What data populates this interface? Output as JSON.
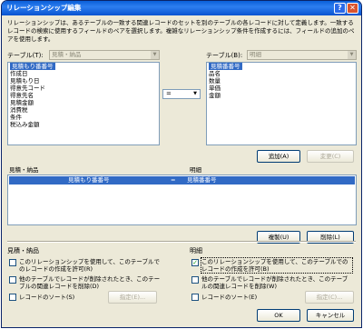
{
  "window": {
    "title": "リレーションシップ編集",
    "help_label": "?",
    "close_label": "✕"
  },
  "description": "リレーションシップは、あるテーブルの一致する関連レコードのセットを別のテーブルの各レコードに対して定義します。一致するレコードの検索に使用するフィールドのペアを選択します。複雑なリレーションシップ条件を作成するには、フィールドの追加のペアを使用します。",
  "left_table": {
    "label": "テーブル(T):",
    "value": "見積・納品",
    "fields": [
      "見積もり番番号",
      "作成日",
      "見積もり日",
      "得意先コード",
      "得意先名",
      "見積金額",
      "消費税",
      "条件",
      "税込み金額"
    ],
    "selected_index": 0
  },
  "right_table": {
    "label": "テーブル(B):",
    "value": "明細",
    "fields": [
      "見積番番号",
      "品名",
      "数量",
      "単価",
      "金額"
    ],
    "selected_index": 0
  },
  "operator": {
    "value": "="
  },
  "buttons": {
    "add": "追加(A)",
    "change": "変更(C)",
    "duplicate": "複製(U)",
    "delete": "削除(L)",
    "left_sort_spec": "指定(E)...",
    "right_sort_spec": "指定(C)...",
    "ok": "OK",
    "cancel": "キャンセル"
  },
  "criteria": {
    "left_header": "見積・納品",
    "right_header": "明細",
    "rows": [
      {
        "left": "見積もり番番号",
        "op": "=",
        "right": "見積番番号"
      }
    ]
  },
  "options_left": {
    "header": "見積・納品",
    "allow_create": "このリレーションシップを使用して、このテーブルでのレコードの作成を許可(R)",
    "allow_create_checked": false,
    "delete_related": "他のテーブルでレコードが削除されたとき、このテーブルの関連レコードを削除(D)",
    "delete_related_checked": false,
    "sort": "レコードのソート(S)",
    "sort_checked": false
  },
  "options_right": {
    "header": "明細",
    "allow_create": "このリレーションシップを使用して、このテーブルでのレコードの作成を許可(B)",
    "allow_create_checked": true,
    "delete_related": "他のテーブルでレコードが削除されたとき、このテーブルの関連レコードを削除(W)",
    "delete_related_checked": false,
    "sort": "レコードのソート(E)",
    "sort_checked": false
  }
}
